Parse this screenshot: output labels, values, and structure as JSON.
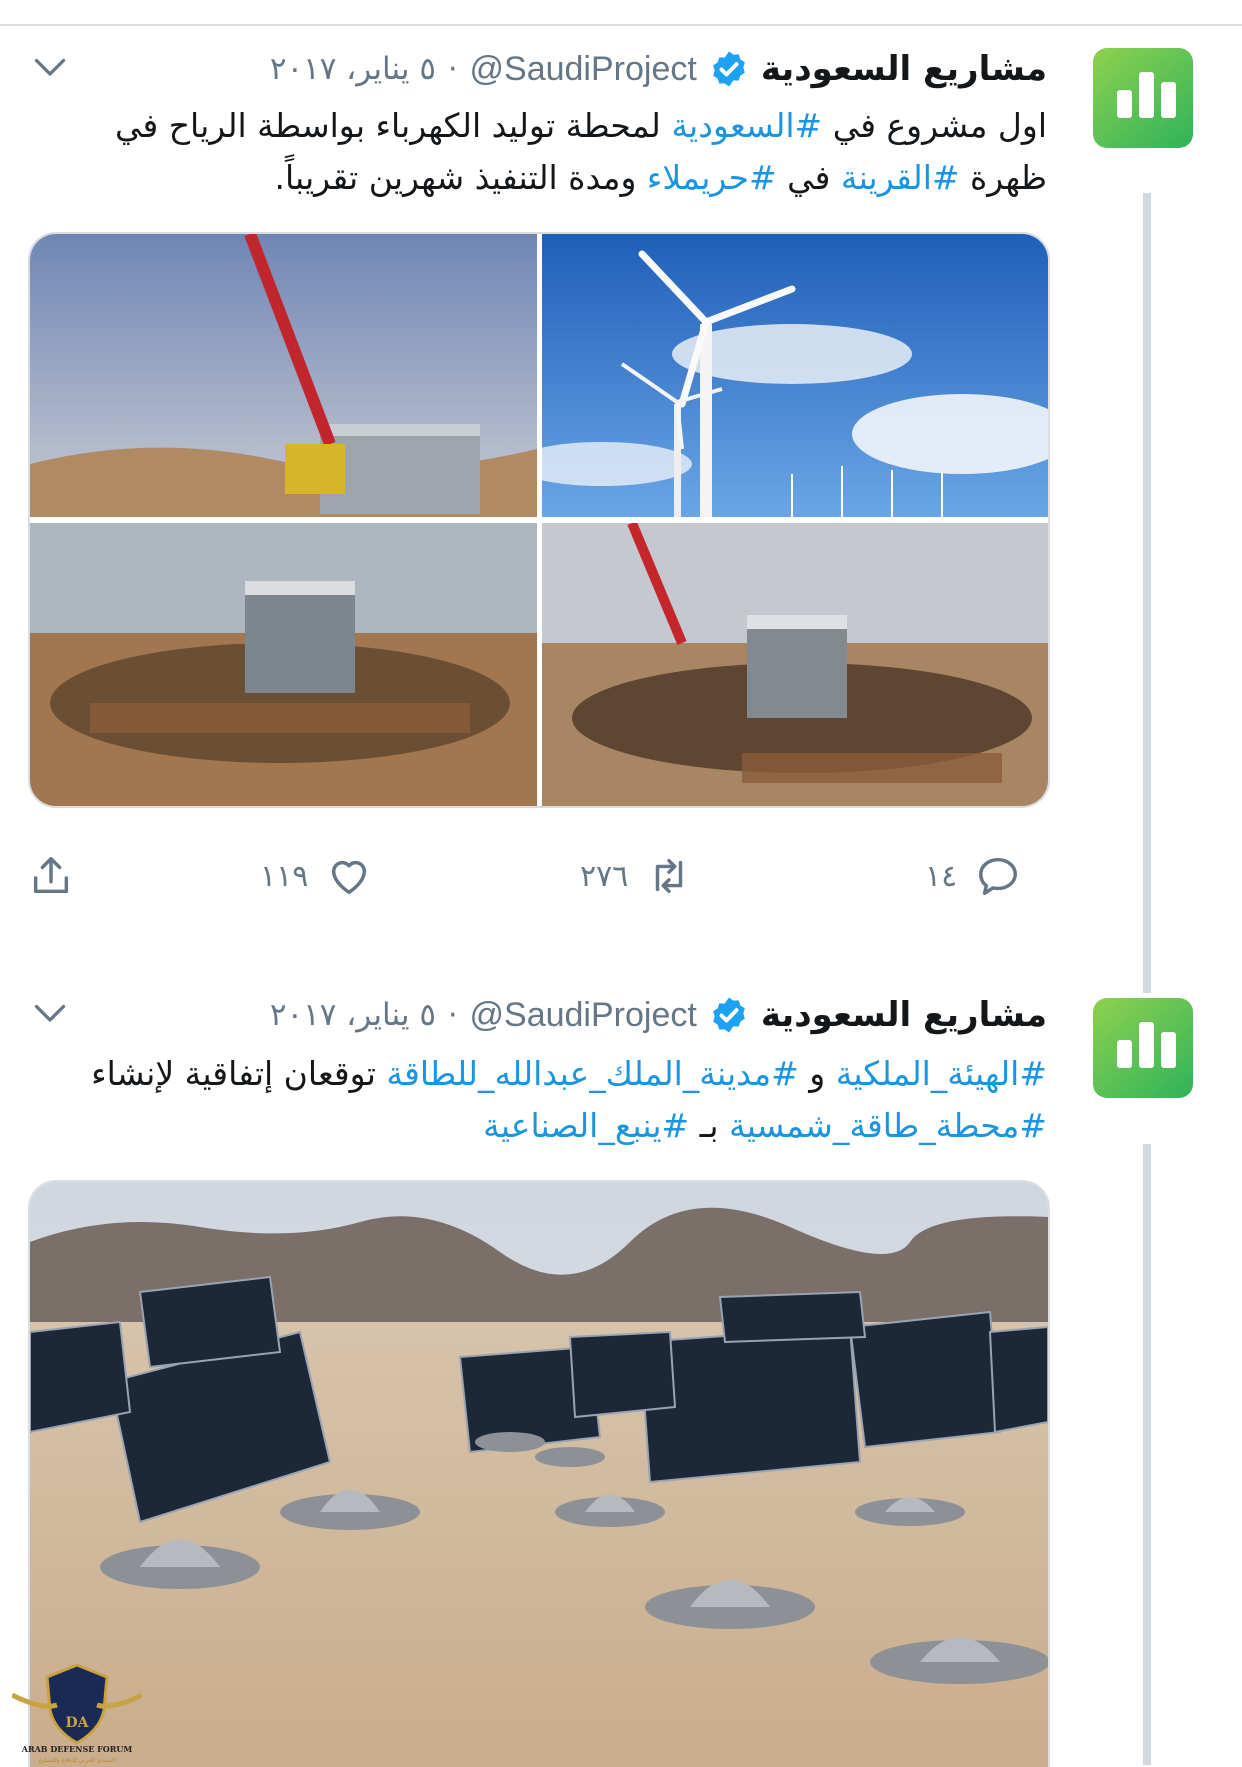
{
  "tweets": [
    {
      "display_name": "مشاريع السعودية",
      "handle": "@SaudiProject",
      "separator": "·",
      "date": "٥ يناير، ٢٠١٧",
      "text_lines": [
        [
          {
            "t": "اول مشروع في ",
            "tag": false
          },
          {
            "t": "#السعودية",
            "tag": true
          },
          {
            "t": " لمحطة توليد الكهرباء بواسطة الرياح في",
            "tag": false
          }
        ],
        [
          {
            "t": "ظهرة ",
            "tag": false
          },
          {
            "t": "#القرينة",
            "tag": true
          },
          {
            "t": " في ",
            "tag": false
          },
          {
            "t": "#حريملاء",
            "tag": true
          },
          {
            "t": " ومدة التنفيذ شهرين تقريباً.",
            "tag": false
          }
        ]
      ],
      "actions": {
        "replies": "١٤",
        "retweets": "٢٧٦",
        "likes": "١١٩"
      }
    },
    {
      "display_name": "مشاريع السعودية",
      "handle": "@SaudiProject",
      "separator": "·",
      "date": "٥ يناير، ٢٠١٧",
      "text_lines": [
        [
          {
            "t": "#الهيئة_الملكية",
            "tag": true
          },
          {
            "t": " و ",
            "tag": false
          },
          {
            "t": "#مدينة_الملك_عبدالله_للطاقة",
            "tag": true
          },
          {
            "t": " توقعان إتفاقية لإنشاء",
            "tag": false
          }
        ],
        [
          {
            "t": "#محطة_طاقة_شمسية",
            "tag": true
          },
          {
            "t": " بـ ",
            "tag": false
          },
          {
            "t": "#ينبع_الصناعية",
            "tag": true
          }
        ]
      ]
    }
  ],
  "icons": {
    "verified": "verified-badge-icon",
    "chevron": "chevron-down-icon",
    "reply": "reply-icon",
    "retweet": "retweet-icon",
    "like": "heart-icon",
    "share": "share-icon"
  },
  "colors": {
    "link": "#1b95e0",
    "meta": "#657786",
    "verified": "#1da1f2",
    "avatar": "#3cb85c"
  },
  "watermark": {
    "label": "ARAB DEFENSE FORUM",
    "sublabel": "المنتدى العربي للدفاع والتسليح"
  }
}
